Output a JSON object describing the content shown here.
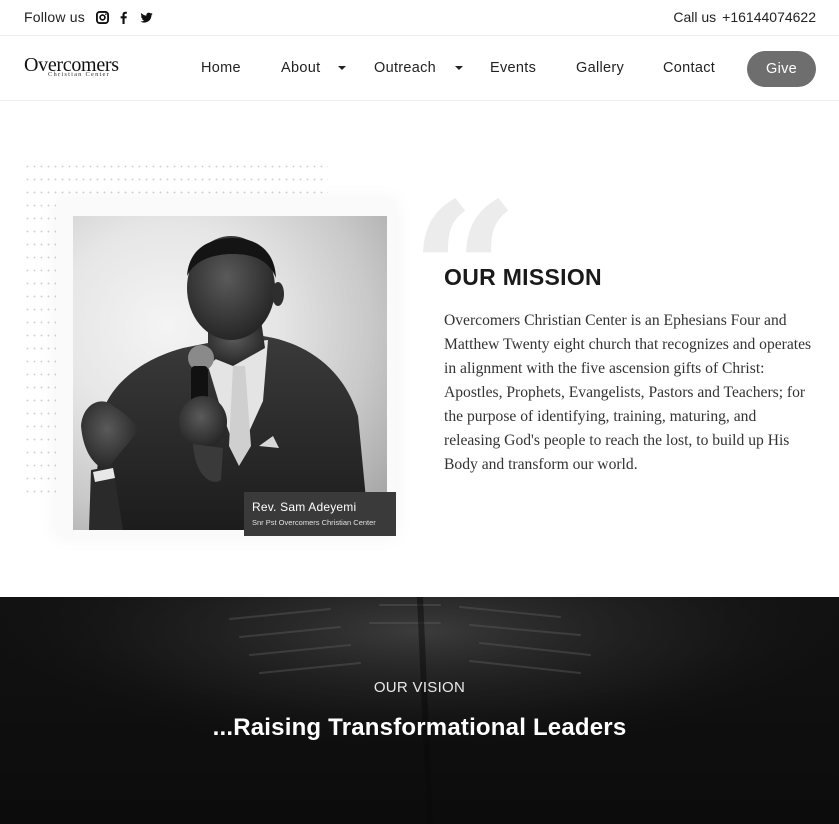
{
  "topbar": {
    "follow_label": "Follow us",
    "social_icons": [
      "instagram-icon",
      "facebook-icon",
      "twitter-icon"
    ],
    "call_label": "Call us",
    "phone": "+16144074622"
  },
  "header": {
    "logo_text": "Overcomers",
    "logo_subtext": "Christian Center",
    "nav": {
      "home": "Home",
      "about": "About",
      "outreach": "Outreach",
      "events": "Events",
      "gallery": "Gallery",
      "contact": "Contact"
    },
    "give_label": "Give"
  },
  "mission": {
    "quote_glyph": "“",
    "title": "OUR MISSION",
    "text": "Overcomers Christian Center is an Ephesians Four and Matthew Twenty eight church that recognizes and operates in alignment with the five ascension gifts of Christ: Apostles, Prophets, Evangelists, Pastors and Teachers; for the purpose of identifying, training, maturing, and releasing God's people to reach the lost, to build up His Body and transform our world.",
    "photo_caption": {
      "name": "Rev. Sam Adeyemi",
      "role": "Snr Pst Overcomers Christian Center"
    }
  },
  "vision": {
    "label": "OUR VISION",
    "headline": "...Raising Transformational Leaders"
  },
  "colors": {
    "give_button": "#6e6e6e",
    "vision_bg": "#111111",
    "caption_bg": "#3a3a3a"
  }
}
